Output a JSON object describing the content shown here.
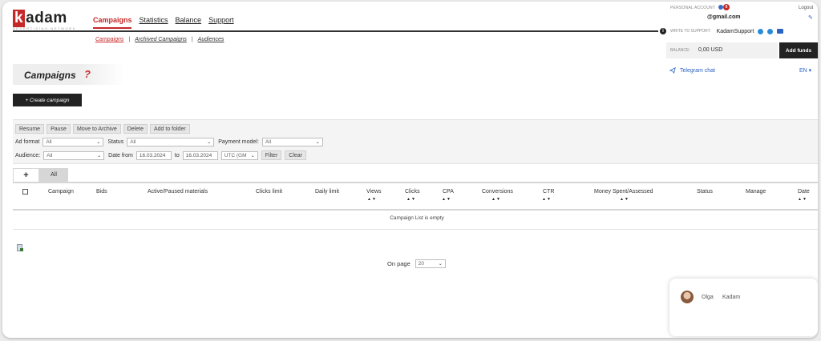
{
  "brand": {
    "name": "adam",
    "letter": "k",
    "tagline": "ADVERTISING NETWORK"
  },
  "nav": {
    "items": [
      "Campaigns",
      "Statistics",
      "Balance",
      "Support"
    ],
    "subnav": [
      "Campaigns",
      "Archived Campaigns",
      "Audiences"
    ],
    "separator": "|"
  },
  "account": {
    "label": "PERSONAL ACCOUNT",
    "notifications": "0",
    "logout": "Logout",
    "email": "@gmail.com",
    "support_label": "WRITE TO SUPPORT:",
    "support_name": "KadamSupport",
    "balance_label": "BALANCE:",
    "balance_value": "0,00 USD",
    "add_funds": "Add funds",
    "telegram": "Telegram chat",
    "language": "EN"
  },
  "page": {
    "title": "Campaigns",
    "help": "?",
    "create_button": "+ Create campaign"
  },
  "actions": [
    "Resume",
    "Pause",
    "Move to Archive",
    "Delete",
    "Add to folder"
  ],
  "filters": {
    "ad_format_label": "Ad format",
    "ad_format_value": "All",
    "status_label": "Status",
    "status_value": "All",
    "payment_label": "Payment model:",
    "payment_value": "All",
    "audience_label": "Audience:",
    "audience_value": "All",
    "date_from_label": "Date from",
    "date_from": "16.03.2024",
    "to_label": "to",
    "date_to": "16.03.2024",
    "timezone": "UTC (GM",
    "filter_button": "Filter",
    "clear_button": "Clear"
  },
  "tabs": {
    "plus": "+",
    "all": "All"
  },
  "table": {
    "columns": [
      "Campaign",
      "Bids",
      "Active/Paused materials",
      "Clicks limit",
      "Daily limit",
      "Views",
      "Clicks",
      "CPA",
      "Conversions",
      "CTR",
      "Money Spent/Assessed",
      "Status",
      "Manage",
      "Date"
    ],
    "sort_glyph": "▲▼",
    "empty_message": "Campaign List is empty"
  },
  "pagination": {
    "label": "On page",
    "value": "20"
  },
  "chat": {
    "name": "Olga",
    "company": "Kadam"
  },
  "colors": {
    "brand_red": "#c62828",
    "link_blue": "#2b63c3",
    "dark": "#222222"
  }
}
